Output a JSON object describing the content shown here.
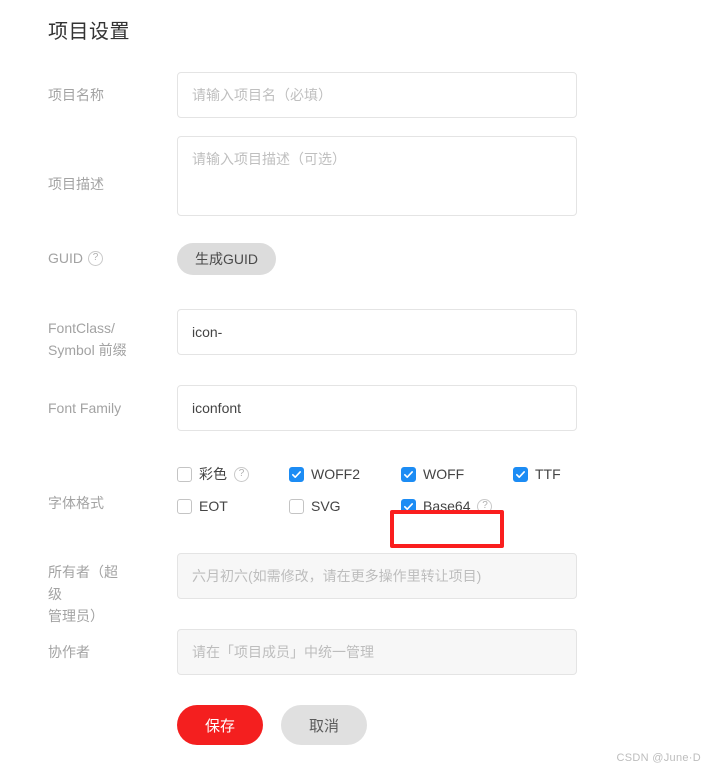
{
  "page": {
    "title": "项目设置",
    "watermark": "CSDN @June·D"
  },
  "fields": {
    "project_name": {
      "label": "项目名称",
      "placeholder": "请输入项目名（必填）",
      "value": ""
    },
    "project_desc": {
      "label": "项目描述",
      "placeholder": "请输入项目描述（可选）",
      "value": ""
    },
    "guid": {
      "label": "GUID",
      "help_icon": "question-circle-icon",
      "button_label": "生成GUID"
    },
    "font_class_prefix": {
      "label_line1": "FontClass/",
      "label_line2": "Symbol 前缀",
      "value": "icon-"
    },
    "font_family": {
      "label": "Font Family",
      "value": "iconfont"
    },
    "font_format": {
      "label": "字体格式",
      "rows": [
        [
          {
            "label": "彩色",
            "checked": false,
            "help": true
          },
          {
            "label": "WOFF2",
            "checked": true,
            "help": false
          },
          {
            "label": "WOFF",
            "checked": true,
            "help": false
          },
          {
            "label": "TTF",
            "checked": true,
            "help": false
          }
        ],
        [
          {
            "label": "EOT",
            "checked": false,
            "help": false
          },
          {
            "label": "SVG",
            "checked": false,
            "help": false
          },
          {
            "label": "Base64",
            "checked": true,
            "help": true
          }
        ]
      ]
    },
    "owner": {
      "label_line1": "所有者（超级",
      "label_line2": "管理员）",
      "placeholder": "六月初六(如需修改，请在更多操作里转让项目)",
      "value": ""
    },
    "collaborator": {
      "label": "协作者",
      "placeholder": "请在「项目成员」中统一管理",
      "value": ""
    }
  },
  "actions": {
    "save_label": "保存",
    "cancel_label": "取消"
  },
  "colors": {
    "checkbox_blue": "#1c8cf4",
    "save_red": "#f41f1f",
    "highlight_red": "#fa1e1e",
    "label_gray": "#a3a3a3"
  }
}
